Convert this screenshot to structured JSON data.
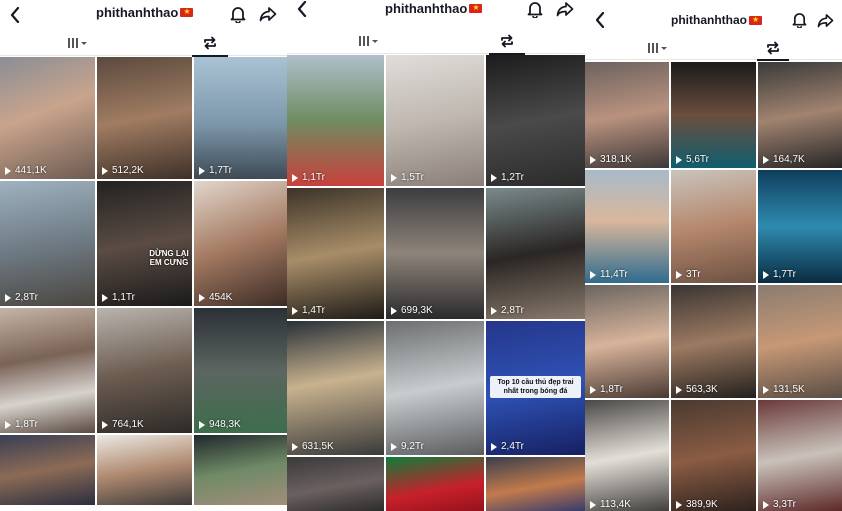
{
  "colors": {
    "text": "#161823",
    "flag": "#da251d",
    "divider": "#e6e6e6"
  },
  "panels": [
    {
      "title": "phithanhthao",
      "tiles": [
        {
          "views": "441,1K",
          "bg": "linear-gradient(160deg,#8a8e96 0%,#c9a48c 45%,#6c5a50 100%)"
        },
        {
          "views": "512,2K",
          "bg": "linear-gradient(170deg,#5b4a3e 0%,#a07c62 50%,#3e3028 100%)"
        },
        {
          "views": "1,7Tr",
          "bg": "linear-gradient(180deg,#a9c2d4 0%,#7d97aa 55%,#3e4a55 100%)"
        },
        {
          "views": "2,8Tr",
          "bg": "linear-gradient(170deg,#9fb2bf 0%,#6f7c86 50%,#4b4640 100%)"
        },
        {
          "views": "1,1Tr",
          "bg": "linear-gradient(170deg,#222 0%,#5b4c44 50%,#1a1a1a 100%)",
          "overlay": "DỪNG LẠI EM CƯNG"
        },
        {
          "views": "454K",
          "bg": "linear-gradient(160deg,#e2d6cc 0%,#a47a62 50%,#3b2b25 100%)"
        },
        {
          "views": "1,8Tr",
          "bg": "linear-gradient(170deg,#c5b4a6 0%,#7a6357 40%,#d7d2cd 70%,#5a4a40 100%)"
        },
        {
          "views": "764,1K",
          "bg": "linear-gradient(170deg,#b9b4ae 0%,#6d5d51 50%,#2d2a28 100%)"
        },
        {
          "views": "948,3K",
          "bg": "linear-gradient(180deg,#2b3036 0%,#5c6560 50%,#3d6e4c 100%)"
        },
        {
          "views": "",
          "bg": "linear-gradient(170deg,#3a3e55 0%,#8c6b55 50%,#2b2e40 100%)"
        },
        {
          "views": "",
          "bg": "linear-gradient(170deg,#ece9e4 0%,#b08a70 50%,#3d3a3a 100%)"
        },
        {
          "views": "",
          "bg": "linear-gradient(170deg,#20282c 0%,#6f8a66 50%,#a28e7a 100%)"
        }
      ]
    },
    {
      "title": "phithanhthao",
      "tiles": [
        {
          "views": "1,1Tr",
          "bg": "linear-gradient(180deg,#aebfcc 0%,#6f8c60 50%,#c9403d 100%)"
        },
        {
          "views": "1,5Tr",
          "bg": "linear-gradient(170deg,#e0ddd9 0%,#bfb7b0 50%,#8a7f78 100%)"
        },
        {
          "views": "1,2Tr",
          "bg": "linear-gradient(170deg,#1c1c1c 0%,#4a4a4a 50%,#2b2b2b 100%)"
        },
        {
          "views": "1,4Tr",
          "bg": "linear-gradient(170deg,#3b3328 0%,#a88d68 50%,#1e1b17 100%)"
        },
        {
          "views": "699,3K",
          "bg": "linear-gradient(180deg,#3c3d40 0%,#8e847a 50%,#2a2a2c 100%)"
        },
        {
          "views": "2,8Tr",
          "bg": "linear-gradient(170deg,#7a8a8c 0%,#2a2624 50%,#8a7a6c 100%)"
        },
        {
          "views": "631,5K",
          "bg": "linear-gradient(170deg,#283038 0%,#c8b28e 45%,#3a3a3a 100%)"
        },
        {
          "views": "9,2Tr",
          "bg": "linear-gradient(170deg,#6c6f70 0%,#c8ccce 50%,#5a5c5e 100%)"
        },
        {
          "views": "2,4Tr",
          "bg": "linear-gradient(170deg,#25368a 0%,#2e52b5 50%,#162062 100%)",
          "banner": "Top 10 cầu thủ đẹp trai nhất trong bóng đá"
        },
        {
          "views": "",
          "bg": "linear-gradient(170deg,#3a3a3a 0%,#6b6060 50%,#222 100%)"
        },
        {
          "views": "",
          "bg": "linear-gradient(170deg,#0e7c3a 0%,#c8202b 55%,#8a1018 100%)"
        },
        {
          "views": "",
          "bg": "linear-gradient(170deg,#3a3f4c 0%,#c27a4c 50%,#1e3070 100%)"
        }
      ]
    },
    {
      "title": "phithanhthao",
      "tiles": [
        {
          "views": "318,1K",
          "bg": "linear-gradient(170deg,#6c6260 0%,#b9927e 50%,#3d3838 100%)"
        },
        {
          "views": "5,6Tr",
          "bg": "linear-gradient(180deg,#1a1a1a 0%,#6b4e3e 50%,#0f5e6f 100%)"
        },
        {
          "views": "164,7K",
          "bg": "linear-gradient(170deg,#3a3a3a 0%,#a18370 50%,#262626 100%)"
        },
        {
          "views": "11,4Tr",
          "bg": "linear-gradient(180deg,#a8bac8 0%,#d8b79c 45%,#2f6c8f 100%)"
        },
        {
          "views": "3Tr",
          "bg": "linear-gradient(170deg,#c9c4bd 0%,#b5876c 50%,#6d5142 100%)"
        },
        {
          "views": "1,7Tr",
          "bg": "linear-gradient(180deg,#0f3e5c 0%,#2f8bb0 50%,#0a2c42 100%)"
        },
        {
          "views": "1,8Tr",
          "bg": "linear-gradient(170deg,#6a6560 0%,#d7b39b 50%,#4a3a32 100%)"
        },
        {
          "views": "563,3K",
          "bg": "linear-gradient(170deg,#3a3532 0%,#9c7a62 50%,#24201d 100%)"
        },
        {
          "views": "131,5K",
          "bg": "linear-gradient(170deg,#8a7c70 0%,#c69876 50%,#5a4d44 100%)"
        },
        {
          "views": "113,4K",
          "bg": "linear-gradient(170deg,#4a4846 0%,#e3dfd8 50%,#3c3a38 100%)"
        },
        {
          "views": "389,9K",
          "bg": "linear-gradient(170deg,#4a3a30 0%,#8a5c44 50%,#2a201c 100%)"
        },
        {
          "views": "3,3Tr",
          "bg": "linear-gradient(170deg,#6a3a3a 0%,#c9c2ba 50%,#5a2424 100%)"
        }
      ]
    }
  ]
}
